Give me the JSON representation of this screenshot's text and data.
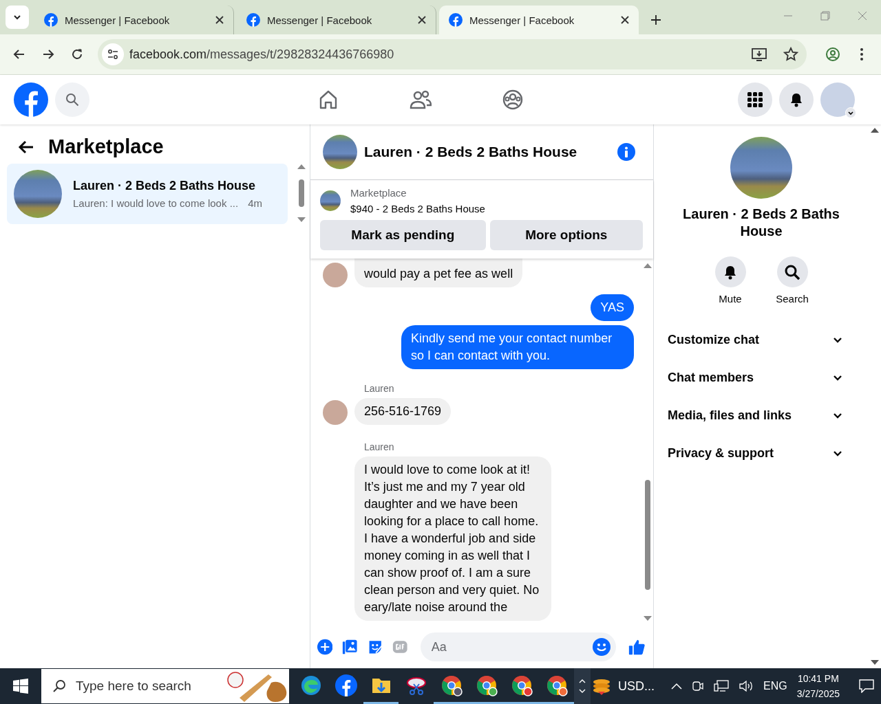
{
  "browser": {
    "tabs": [
      {
        "title": "Messenger | Facebook",
        "selected": false
      },
      {
        "title": "Messenger | Facebook",
        "selected": false
      },
      {
        "title": "Messenger | Facebook",
        "selected": true
      }
    ],
    "address": {
      "domain": "facebook.com",
      "path": "/messages/t/29828324436766980"
    }
  },
  "thread_list": {
    "title": "Marketplace",
    "threads": [
      {
        "name": "Lauren · 2 Beds 2 Baths House",
        "preview": "Lauren: I would love to come look ...",
        "time": "4m",
        "selected": true
      }
    ]
  },
  "chat": {
    "title": "Lauren · 2 Beds 2 Baths House",
    "listing": {
      "label": "Marketplace",
      "summary": "$940 - 2 Beds 2 Baths House",
      "buttons": [
        "Mark as pending",
        "More options"
      ]
    },
    "messages": [
      {
        "kind": "incoming",
        "avatar": true,
        "text": "would pay a pet fee as well"
      },
      {
        "kind": "outgoing",
        "text": "YAS"
      },
      {
        "kind": "outgoing",
        "text": "Kindly send me your contact number so I can contact with you."
      },
      {
        "kind": "incoming",
        "sender": "Lauren",
        "avatar": true,
        "text": "256-516-1769"
      },
      {
        "kind": "incoming",
        "sender": "Lauren",
        "avatar": false,
        "text": "I would love to come look at it! It’s just me and my 7 year old daughter and we have been looking for a place to call home. I have a wonderful job and side money coming in as well that I can show proof of. I am a sure clean person and very quiet. No eary/late noise around the"
      }
    ],
    "composer": {
      "placeholder": "Aa"
    }
  },
  "details": {
    "title": "Lauren · 2 Beds 2 Baths House",
    "actions": [
      "Mute",
      "Search"
    ],
    "sections": [
      {
        "label": "Customize chat",
        "expanded": false
      },
      {
        "label": "Chat members",
        "expanded": false
      },
      {
        "label": "Media, files and links",
        "expanded": false
      },
      {
        "label": "Privacy & support",
        "expanded": false
      }
    ]
  },
  "taskbar": {
    "search_placeholder": "Type here to search",
    "tray_app": "USD...",
    "language": "ENG",
    "time": "10:41 PM",
    "date": "3/27/2025"
  }
}
